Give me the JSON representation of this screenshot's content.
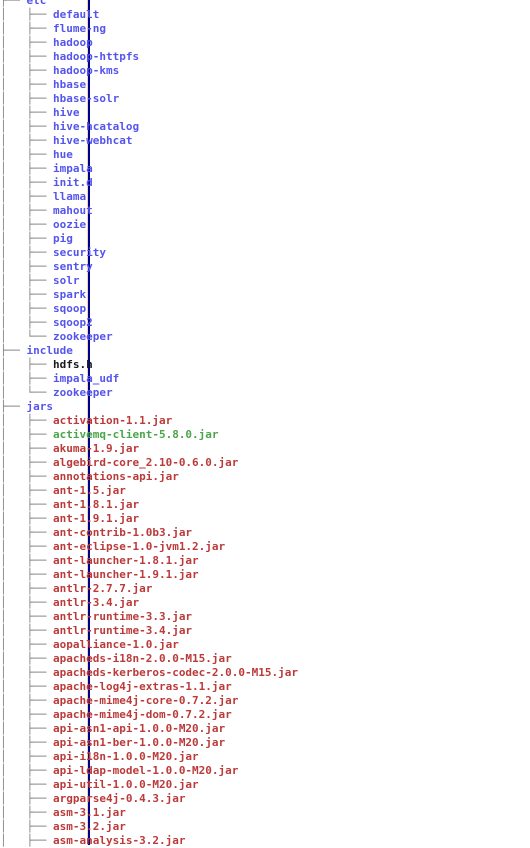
{
  "terminal": {
    "command_context": "tree",
    "background_color": "#ffffff",
    "colors": {
      "directory": "#5555ee",
      "file": "#1a1a1a",
      "archive": "#bb3a3a",
      "executable": "#4ba54b",
      "guide": "#808080",
      "root_guide": "#00008b"
    }
  },
  "tree": {
    "clipped_top_row": {
      "name": "",
      "type": "executable",
      "note": "row clipped by top edge of capture"
    },
    "nodes": [
      {
        "name": "etc",
        "type": "dir",
        "depth": 1,
        "connector": "tee"
      },
      {
        "name": "default",
        "type": "dir",
        "depth": 2,
        "connector": "tee"
      },
      {
        "name": "flume-ng",
        "type": "dir",
        "depth": 2,
        "connector": "tee"
      },
      {
        "name": "hadoop",
        "type": "dir",
        "depth": 2,
        "connector": "tee"
      },
      {
        "name": "hadoop-httpfs",
        "type": "dir",
        "depth": 2,
        "connector": "tee"
      },
      {
        "name": "hadoop-kms",
        "type": "dir",
        "depth": 2,
        "connector": "tee"
      },
      {
        "name": "hbase",
        "type": "dir",
        "depth": 2,
        "connector": "tee"
      },
      {
        "name": "hbase-solr",
        "type": "dir",
        "depth": 2,
        "connector": "tee"
      },
      {
        "name": "hive",
        "type": "dir",
        "depth": 2,
        "connector": "tee"
      },
      {
        "name": "hive-hcatalog",
        "type": "dir",
        "depth": 2,
        "connector": "tee"
      },
      {
        "name": "hive-webhcat",
        "type": "dir",
        "depth": 2,
        "connector": "tee"
      },
      {
        "name": "hue",
        "type": "dir",
        "depth": 2,
        "connector": "tee"
      },
      {
        "name": "impala",
        "type": "dir",
        "depth": 2,
        "connector": "tee"
      },
      {
        "name": "init.d",
        "type": "dir",
        "depth": 2,
        "connector": "tee"
      },
      {
        "name": "llama",
        "type": "dir",
        "depth": 2,
        "connector": "tee"
      },
      {
        "name": "mahout",
        "type": "dir",
        "depth": 2,
        "connector": "tee"
      },
      {
        "name": "oozie",
        "type": "dir",
        "depth": 2,
        "connector": "tee"
      },
      {
        "name": "pig",
        "type": "dir",
        "depth": 2,
        "connector": "tee"
      },
      {
        "name": "security",
        "type": "dir",
        "depth": 2,
        "connector": "tee"
      },
      {
        "name": "sentry",
        "type": "dir",
        "depth": 2,
        "connector": "tee"
      },
      {
        "name": "solr",
        "type": "dir",
        "depth": 2,
        "connector": "tee"
      },
      {
        "name": "spark",
        "type": "dir",
        "depth": 2,
        "connector": "tee"
      },
      {
        "name": "sqoop",
        "type": "dir",
        "depth": 2,
        "connector": "tee"
      },
      {
        "name": "sqoop2",
        "type": "dir",
        "depth": 2,
        "connector": "tee"
      },
      {
        "name": "zookeeper",
        "type": "dir",
        "depth": 2,
        "connector": "elbow"
      },
      {
        "name": "include",
        "type": "dir",
        "depth": 1,
        "connector": "tee"
      },
      {
        "name": "hdfs.h",
        "type": "file",
        "depth": 2,
        "connector": "tee"
      },
      {
        "name": "impala_udf",
        "type": "dir",
        "depth": 2,
        "connector": "tee"
      },
      {
        "name": "zookeeper",
        "type": "dir",
        "depth": 2,
        "connector": "elbow"
      },
      {
        "name": "jars",
        "type": "dir",
        "depth": 1,
        "connector": "tee"
      },
      {
        "name": "activation-1.1.jar",
        "type": "archive",
        "depth": 2,
        "connector": "tee"
      },
      {
        "name": "activemq-client-5.8.0.jar",
        "type": "exec",
        "depth": 2,
        "connector": "tee"
      },
      {
        "name": "akuma-1.9.jar",
        "type": "archive",
        "depth": 2,
        "connector": "tee"
      },
      {
        "name": "algebird-core_2.10-0.6.0.jar",
        "type": "archive",
        "depth": 2,
        "connector": "tee"
      },
      {
        "name": "annotations-api.jar",
        "type": "archive",
        "depth": 2,
        "connector": "tee"
      },
      {
        "name": "ant-1.5.jar",
        "type": "archive",
        "depth": 2,
        "connector": "tee"
      },
      {
        "name": "ant-1.8.1.jar",
        "type": "archive",
        "depth": 2,
        "connector": "tee"
      },
      {
        "name": "ant-1.9.1.jar",
        "type": "archive",
        "depth": 2,
        "connector": "tee"
      },
      {
        "name": "ant-contrib-1.0b3.jar",
        "type": "archive",
        "depth": 2,
        "connector": "tee"
      },
      {
        "name": "ant-eclipse-1.0-jvm1.2.jar",
        "type": "archive",
        "depth": 2,
        "connector": "tee"
      },
      {
        "name": "ant-launcher-1.8.1.jar",
        "type": "archive",
        "depth": 2,
        "connector": "tee"
      },
      {
        "name": "ant-launcher-1.9.1.jar",
        "type": "archive",
        "depth": 2,
        "connector": "tee"
      },
      {
        "name": "antlr-2.7.7.jar",
        "type": "archive",
        "depth": 2,
        "connector": "tee"
      },
      {
        "name": "antlr-3.4.jar",
        "type": "archive",
        "depth": 2,
        "connector": "tee"
      },
      {
        "name": "antlr-runtime-3.3.jar",
        "type": "archive",
        "depth": 2,
        "connector": "tee"
      },
      {
        "name": "antlr-runtime-3.4.jar",
        "type": "archive",
        "depth": 2,
        "connector": "tee"
      },
      {
        "name": "aopalliance-1.0.jar",
        "type": "archive",
        "depth": 2,
        "connector": "tee"
      },
      {
        "name": "apacheds-i18n-2.0.0-M15.jar",
        "type": "archive",
        "depth": 2,
        "connector": "tee"
      },
      {
        "name": "apacheds-kerberos-codec-2.0.0-M15.jar",
        "type": "archive",
        "depth": 2,
        "connector": "tee"
      },
      {
        "name": "apache-log4j-extras-1.1.jar",
        "type": "archive",
        "depth": 2,
        "connector": "tee"
      },
      {
        "name": "apache-mime4j-core-0.7.2.jar",
        "type": "archive",
        "depth": 2,
        "connector": "tee"
      },
      {
        "name": "apache-mime4j-dom-0.7.2.jar",
        "type": "archive",
        "depth": 2,
        "connector": "tee"
      },
      {
        "name": "api-asn1-api-1.0.0-M20.jar",
        "type": "archive",
        "depth": 2,
        "connector": "tee"
      },
      {
        "name": "api-asn1-ber-1.0.0-M20.jar",
        "type": "archive",
        "depth": 2,
        "connector": "tee"
      },
      {
        "name": "api-i18n-1.0.0-M20.jar",
        "type": "archive",
        "depth": 2,
        "connector": "tee"
      },
      {
        "name": "api-ldap-model-1.0.0-M20.jar",
        "type": "archive",
        "depth": 2,
        "connector": "tee"
      },
      {
        "name": "api-util-1.0.0-M20.jar",
        "type": "archive",
        "depth": 2,
        "connector": "tee"
      },
      {
        "name": "argparse4j-0.4.3.jar",
        "type": "archive",
        "depth": 2,
        "connector": "tee"
      },
      {
        "name": "asm-3.1.jar",
        "type": "archive",
        "depth": 2,
        "connector": "tee"
      },
      {
        "name": "asm-3.2.jar",
        "type": "archive",
        "depth": 2,
        "connector": "tee"
      },
      {
        "name": "asm-analysis-3.2.jar",
        "type": "archive",
        "depth": 2,
        "connector": "tee",
        "clipped": true
      }
    ]
  },
  "glyphs": {
    "tee": "├── ",
    "elbow": "└── ",
    "pipe": "│   ",
    "blank": "    "
  }
}
